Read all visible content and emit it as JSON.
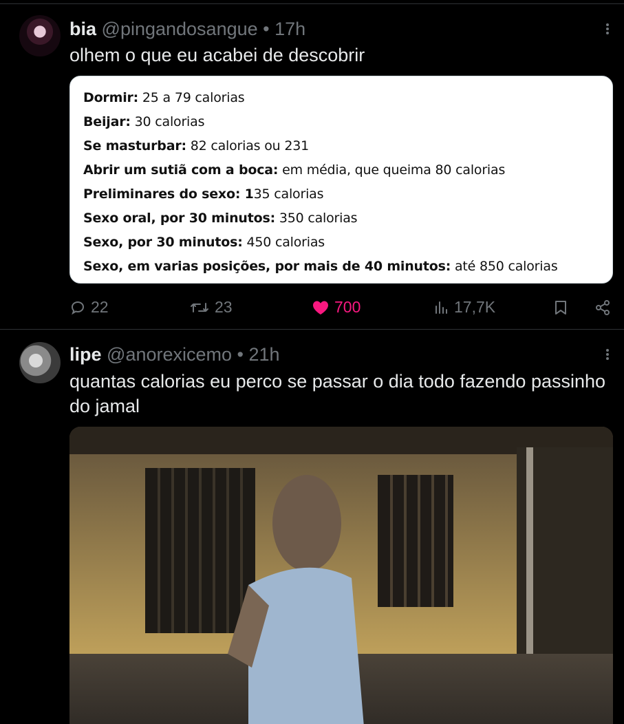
{
  "tweets": [
    {
      "name": "bia",
      "handle": "@pingandosangue",
      "separator": "•",
      "time": "17h",
      "text": "olhem o que eu acabei de descobrir",
      "card_rows": [
        {
          "label": "Dormir:",
          "value": " 25 a 79 calorias"
        },
        {
          "label": "Beijar:",
          "value": " 30 calorias"
        },
        {
          "label": "Se masturbar:",
          "value": " 82 calorias ou 231"
        },
        {
          "label": "Abrir um sutiã com a boca:",
          "value": " em média, que queima 80 calorias"
        },
        {
          "label": "Preliminares do sexo: 1",
          "value": "35 calorias"
        },
        {
          "label": "Sexo oral, por 30 minutos:",
          "value": " 350 calorias"
        },
        {
          "label": "Sexo, por 30 minutos:",
          "value": " 450 calorias"
        },
        {
          "label": "Sexo, em varias posições, por mais de 40 minutos:",
          "value": " até 850 calorias"
        }
      ],
      "actions": {
        "replies": "22",
        "retweets": "23",
        "likes": "700",
        "views": "17,7K"
      }
    },
    {
      "name": "lipe",
      "handle": "@anorexicemo",
      "separator": "•",
      "time": "21h",
      "text": "quantas calorias eu perco se passar o dia todo fazendo passinho do jamal"
    }
  ],
  "icons": {
    "more": "more-vertical-icon",
    "reply": "reply-icon",
    "retweet": "retweet-icon",
    "like": "heart-filled-icon",
    "views": "views-chart-icon",
    "bookmark": "bookmark-icon",
    "share": "share-icon"
  },
  "colors": {
    "background": "#000000",
    "text": "#e7e9ea",
    "muted": "#71767b",
    "like": "#f91880",
    "divider": "#2f3336"
  }
}
